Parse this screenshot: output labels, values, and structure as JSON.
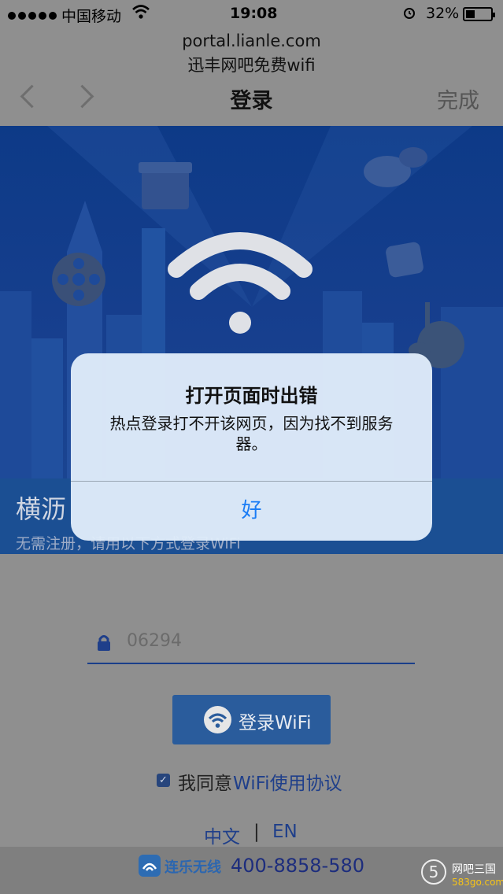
{
  "status_bar": {
    "carrier": "中国移动",
    "time": "19:08",
    "battery_pct": "32%",
    "battery_level": 0.32
  },
  "browser": {
    "url": "portal.lianle.com",
    "page_title": "迅丰网吧免费wifi",
    "nav_title": "登录",
    "done_label": "完成"
  },
  "portal": {
    "venue_name": "横沥",
    "hint": "无需注册，请用以下方式登录WiFi",
    "code_value": "06294",
    "login_label": "登录WiFi",
    "agree_prefix": "我同意",
    "agree_link": "WiFi使用协议",
    "lang_zh": "中文",
    "lang_sep": "|",
    "lang_en": "EN",
    "brand_name": "连乐无线",
    "phone": "400-8858-580"
  },
  "watermark": {
    "glyph": "5",
    "name": "网吧三国",
    "url": "583go.com"
  },
  "dialog": {
    "title": "打开页面时出错",
    "message": "热点登录打不开该网页，因为找不到服务器。",
    "ok_label": "好"
  },
  "colors": {
    "accent": "#1a7cf5",
    "brand": "#1f3f8a"
  }
}
